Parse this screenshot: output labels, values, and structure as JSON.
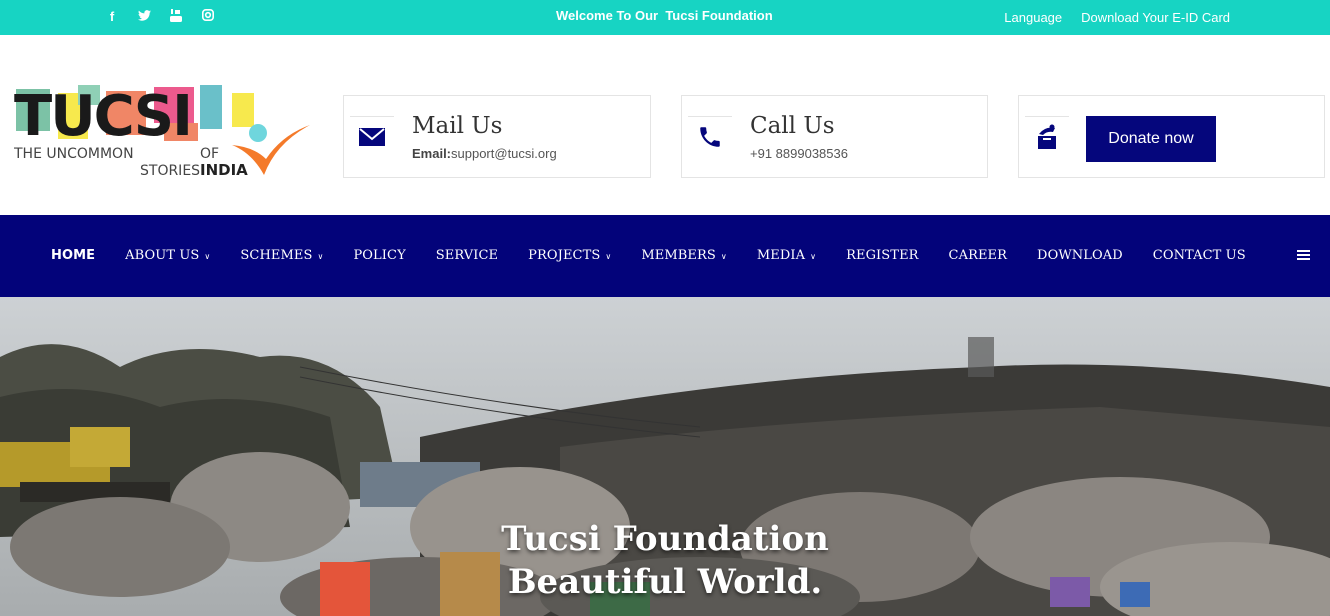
{
  "topbar": {
    "social_icons": [
      "facebook-icon",
      "twitter-icon",
      "youtube-icon",
      "instagram-icon"
    ],
    "welcome_text": "Welcome To Our  Tucsi Foundation",
    "language_label": "Language",
    "eid_label": "Download Your E-ID Card"
  },
  "logo": {
    "wordmark": "TUCSI",
    "line1": "THE UNCOMMON",
    "line1_of": "OF",
    "line2a": "STORIES",
    "line2b": "INDIA"
  },
  "contact": {
    "mail_title": "Mail Us",
    "mail_label": "Email:",
    "mail_value": "support@tucsi.org",
    "call_title": "Call Us",
    "call_value": "+91 8899038536",
    "donate_label": "Donate now"
  },
  "nav": {
    "items": [
      {
        "label": "HOME",
        "dropdown": false
      },
      {
        "label": "ABOUT US",
        "dropdown": true
      },
      {
        "label": "SCHEMES",
        "dropdown": true
      },
      {
        "label": "POLICY",
        "dropdown": false
      },
      {
        "label": "SERVICE",
        "dropdown": false
      },
      {
        "label": "PROJECTS",
        "dropdown": true
      },
      {
        "label": "MEMBERS",
        "dropdown": true
      },
      {
        "label": "MEDIA",
        "dropdown": true
      },
      {
        "label": "REGISTER",
        "dropdown": false
      },
      {
        "label": "CAREER",
        "dropdown": false
      },
      {
        "label": "DOWNLOAD",
        "dropdown": false
      },
      {
        "label": "CONTACT US",
        "dropdown": false
      }
    ]
  },
  "hero": {
    "title_line1": "Tucsi Foundation",
    "title_line2": "Beautiful World."
  },
  "colors": {
    "topbar": "#17d4c3",
    "nav": "#03037a",
    "donate": "#05067c"
  }
}
